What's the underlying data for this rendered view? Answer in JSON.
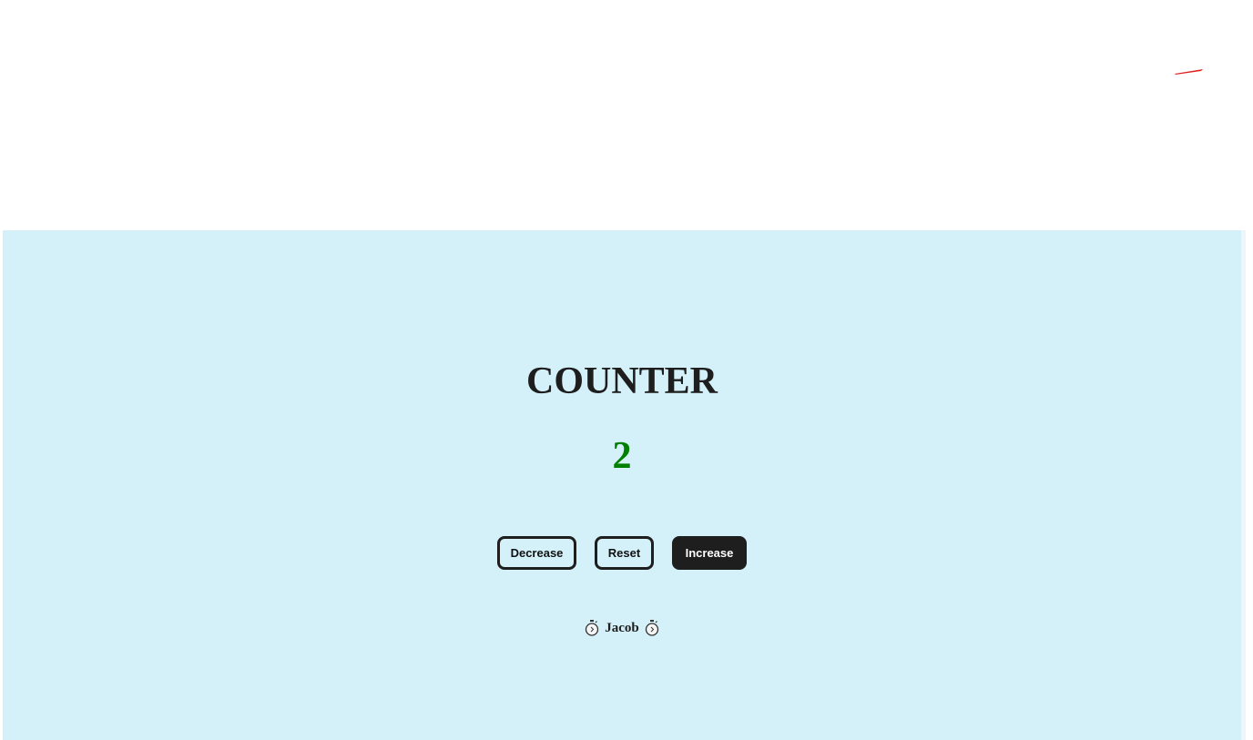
{
  "app": {
    "title": "COUNTER",
    "count": "2",
    "count_color": "#008000"
  },
  "buttons": {
    "decrease_label": "Decrease",
    "reset_label": "Reset",
    "increase_label": "Increase"
  },
  "footer": {
    "author": "Jacob",
    "icon": "stopwatch-icon"
  },
  "colors": {
    "panel_background": "#d4f1fa",
    "primary_dark": "#1e1e1e",
    "accent_red": "#e02020"
  }
}
